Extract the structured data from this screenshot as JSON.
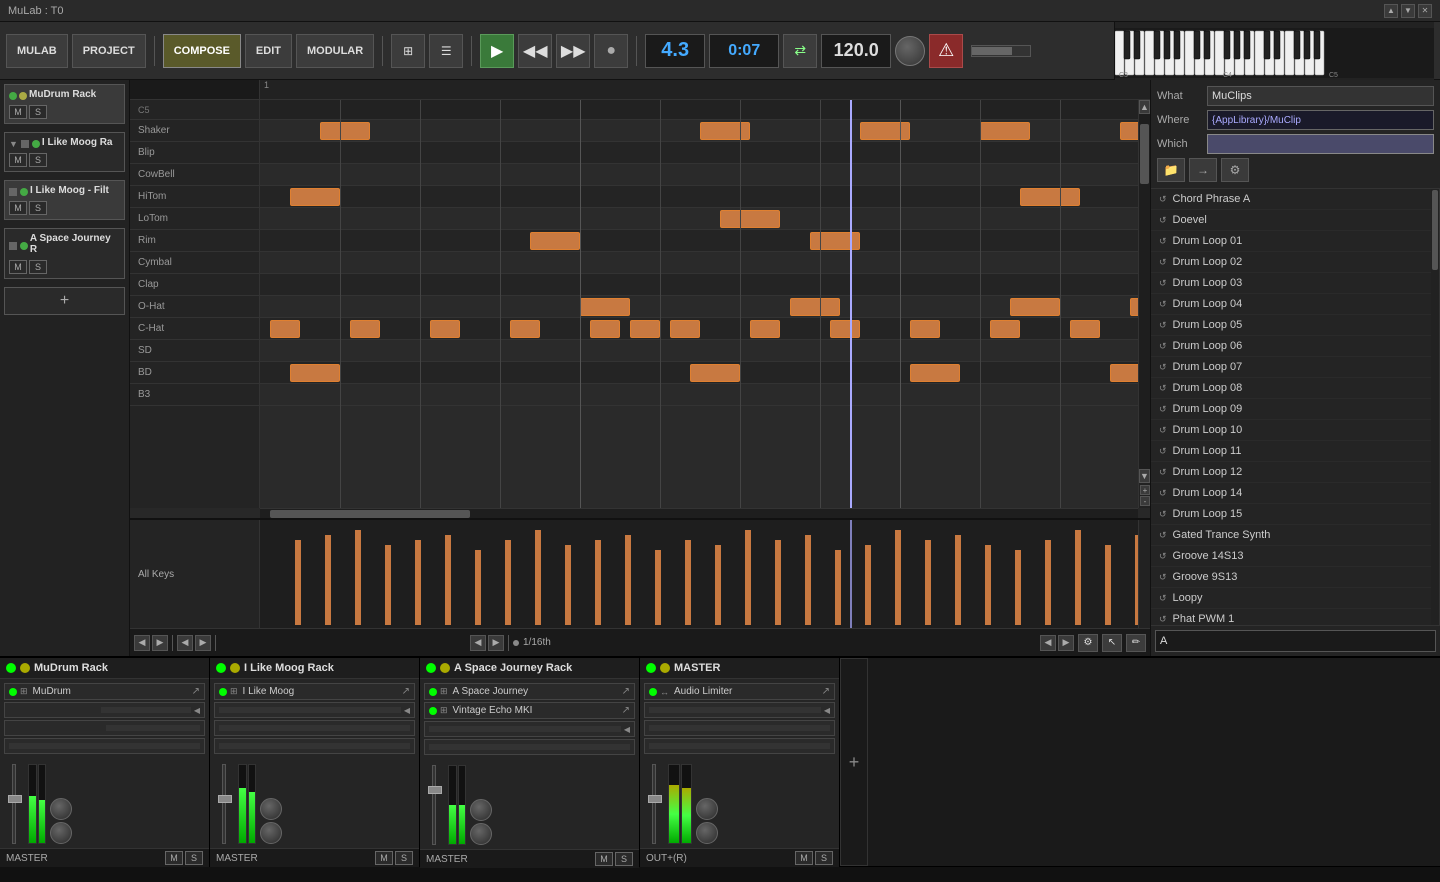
{
  "app": {
    "title": "MuLab : T0",
    "titlebar_controls": [
      "▲",
      "▼",
      "✕"
    ]
  },
  "toolbar": {
    "mulab_label": "MULAB",
    "project_label": "PROJECT",
    "compose_label": "COMPOSE",
    "edit_label": "EDIT",
    "modular_label": "MODULAR",
    "position": "4.3",
    "time": "0:07",
    "tempo": "120.0"
  },
  "sidebar": {
    "items": [
      {
        "name": "MuDrum Rack",
        "color": "green"
      },
      {
        "name": "I Like Moog Ra",
        "color": "green",
        "collapsed": false
      },
      {
        "name": "I Like Moog - Filt",
        "color": "green"
      },
      {
        "name": "A Space Journey R",
        "color": "green"
      }
    ],
    "add_label": "+"
  },
  "roll": {
    "bar_numbers": [
      "1"
    ],
    "note_rows": [
      {
        "label": "C5",
        "dark": false
      },
      {
        "label": "Shaker",
        "dark": false
      },
      {
        "label": "Blip",
        "dark": false
      },
      {
        "label": "CowBell",
        "dark": false
      },
      {
        "label": "HiTom",
        "dark": false
      },
      {
        "label": "LoTom",
        "dark": false
      },
      {
        "label": "Rim",
        "dark": false
      },
      {
        "label": "Cymbal",
        "dark": false
      },
      {
        "label": "Clap",
        "dark": false
      },
      {
        "label": "O-Hat",
        "dark": false
      },
      {
        "label": "C-Hat",
        "dark": false
      },
      {
        "label": "SD",
        "dark": false
      },
      {
        "label": "BD",
        "dark": false
      },
      {
        "label": "B3",
        "dark": false
      }
    ],
    "vel_label": "All Keys",
    "resolution": "1/16th"
  },
  "right_panel": {
    "what_label": "What",
    "what_value": "MuClips",
    "where_label": "Where",
    "where_value": "{AppLibrary}/MuClip",
    "which_label": "Which",
    "which_value": "",
    "folder_icon": "📁",
    "arrow_icon": "→",
    "gear_icon": "⚙",
    "list_items": [
      {
        "icon": "↺",
        "name": "Chord Phrase A"
      },
      {
        "icon": "↺",
        "name": "Doevel"
      },
      {
        "icon": "↺",
        "name": "Drum Loop 01"
      },
      {
        "icon": "↺",
        "name": "Drum Loop 02"
      },
      {
        "icon": "↺",
        "name": "Drum Loop 03"
      },
      {
        "icon": "↺",
        "name": "Drum Loop 04"
      },
      {
        "icon": "↺",
        "name": "Drum Loop 05"
      },
      {
        "icon": "↺",
        "name": "Drum Loop 06"
      },
      {
        "icon": "↺",
        "name": "Drum Loop 07"
      },
      {
        "icon": "↺",
        "name": "Drum Loop 08"
      },
      {
        "icon": "↺",
        "name": "Drum Loop 09"
      },
      {
        "icon": "↺",
        "name": "Drum Loop 10"
      },
      {
        "icon": "↺",
        "name": "Drum Loop 11"
      },
      {
        "icon": "↺",
        "name": "Drum Loop 12"
      },
      {
        "icon": "↺",
        "name": "Drum Loop 14"
      },
      {
        "icon": "↺",
        "name": "Drum Loop 15"
      },
      {
        "icon": "↺",
        "name": "Gated Trance Synth"
      },
      {
        "icon": "↺",
        "name": "Groove 14S13"
      },
      {
        "icon": "↺",
        "name": "Groove 9S13"
      },
      {
        "icon": "↺",
        "name": "Loopy"
      },
      {
        "icon": "↺",
        "name": "Phat PWM 1"
      }
    ],
    "search_placeholder": "A"
  },
  "mixer": {
    "channels": [
      {
        "name": "MuDrum Rack",
        "led1": "green",
        "led2": "yellow",
        "plugins": [
          {
            "name": "MuDrum",
            "led": "green"
          }
        ],
        "footer": "MASTER"
      },
      {
        "name": "I Like Moog Rack",
        "led1": "green",
        "led2": "yellow",
        "plugins": [
          {
            "name": "I Like Moog",
            "led": "green"
          }
        ],
        "footer": "MASTER"
      },
      {
        "name": "A Space Journey Rack",
        "led1": "green",
        "led2": "yellow",
        "plugins": [
          {
            "name": "A Space Journey",
            "led": "green"
          },
          {
            "name": "Vintage Echo MKI",
            "led": "green"
          }
        ],
        "footer": "MASTER",
        "sublabels": [
          "Space Journey Rack",
          "Space Journey"
        ]
      },
      {
        "name": "MASTER",
        "led1": "green",
        "led2": "yellow",
        "plugins": [
          {
            "name": "Audio Limiter",
            "led": "green"
          }
        ],
        "footer": "OUT+(R)"
      }
    ],
    "add_label": "+"
  }
}
